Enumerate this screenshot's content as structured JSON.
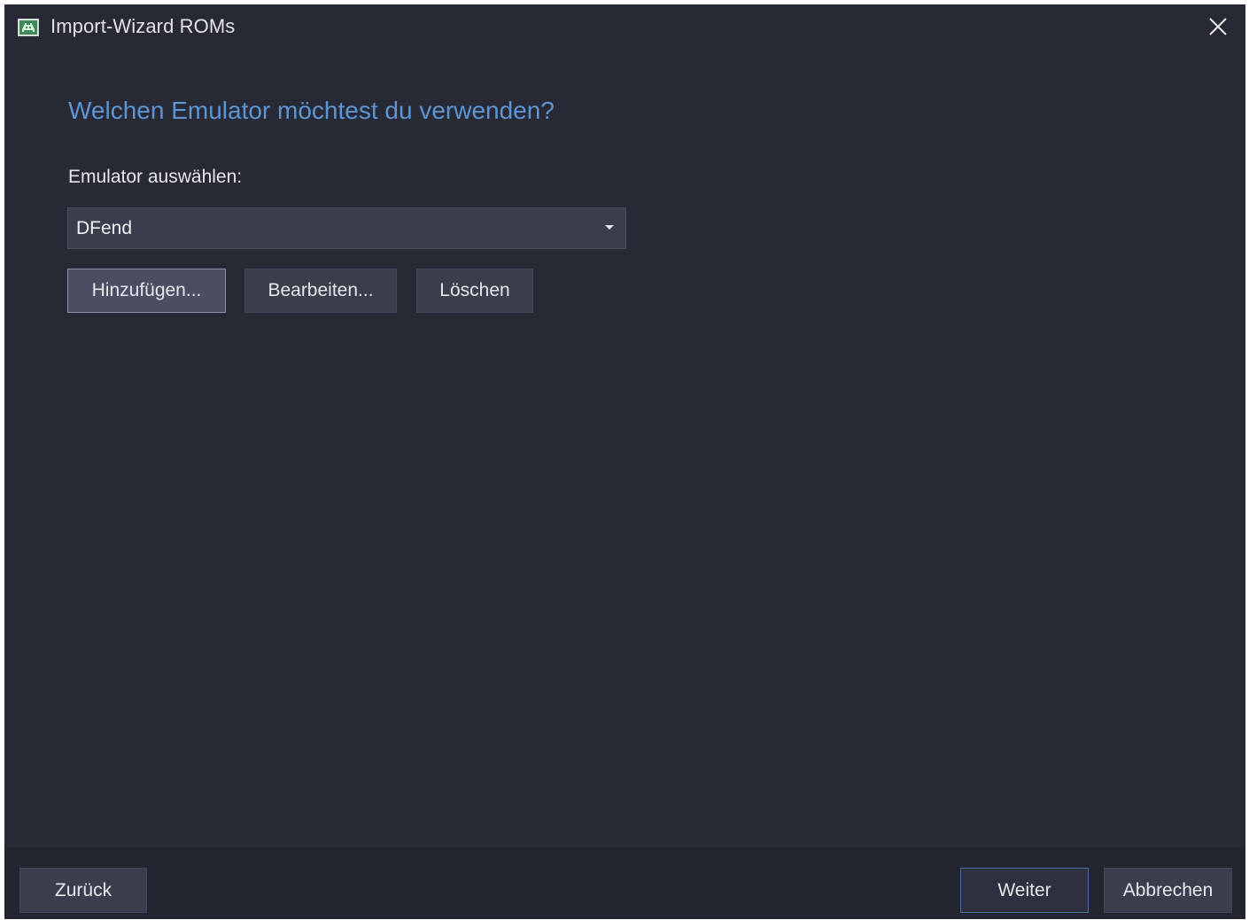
{
  "window": {
    "title": "Import-Wizard ROMs",
    "icon": "space-invader-icon",
    "close_icon": "close-icon"
  },
  "main": {
    "heading": "Welchen Emulator möchtest du verwenden?",
    "emulator_label": "Emulator auswählen:",
    "emulator_select": {
      "value": "DFend"
    },
    "buttons": {
      "add": "Hinzufügen...",
      "edit": "Bearbeiten...",
      "delete": "Löschen"
    }
  },
  "footer": {
    "back": "Zurück",
    "next": "Weiter",
    "cancel": "Abbrechen"
  },
  "colors": {
    "background": "#272935",
    "heading": "#5d95d4",
    "accent_border": "#4a6ba4"
  }
}
